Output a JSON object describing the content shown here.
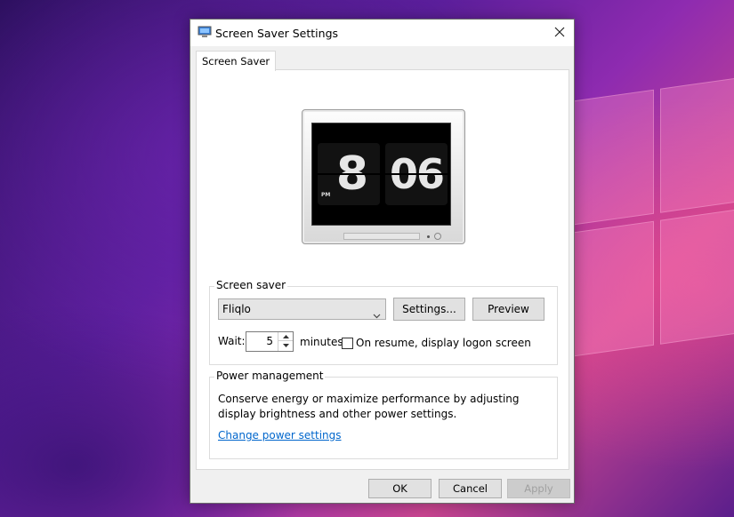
{
  "window": {
    "title": "Screen Saver Settings",
    "icon": "monitor-app-icon",
    "close_icon": "close-icon"
  },
  "tabs": [
    {
      "label": "Screen Saver",
      "active": true
    }
  ],
  "preview": {
    "hours": "8",
    "minutes": "06",
    "ampm": "PM"
  },
  "screen_saver": {
    "group_label": "Screen saver",
    "selected": "Fliqlo",
    "settings_label": "Settings...",
    "preview_label": "Preview",
    "wait_label": "Wait:",
    "wait_value": "5",
    "minutes_label": "minutes",
    "resume_label": "On resume, display logon screen",
    "resume_checked": false
  },
  "power_management": {
    "group_label": "Power management",
    "description": "Conserve energy or maximize performance by adjusting display brightness and other power settings.",
    "link": "Change power settings"
  },
  "footer": {
    "ok": "OK",
    "cancel": "Cancel",
    "apply": "Apply"
  },
  "colors": {
    "link": "#0066cc",
    "button_face": "#e1e1e1",
    "window_bg": "#f0f0f0"
  }
}
